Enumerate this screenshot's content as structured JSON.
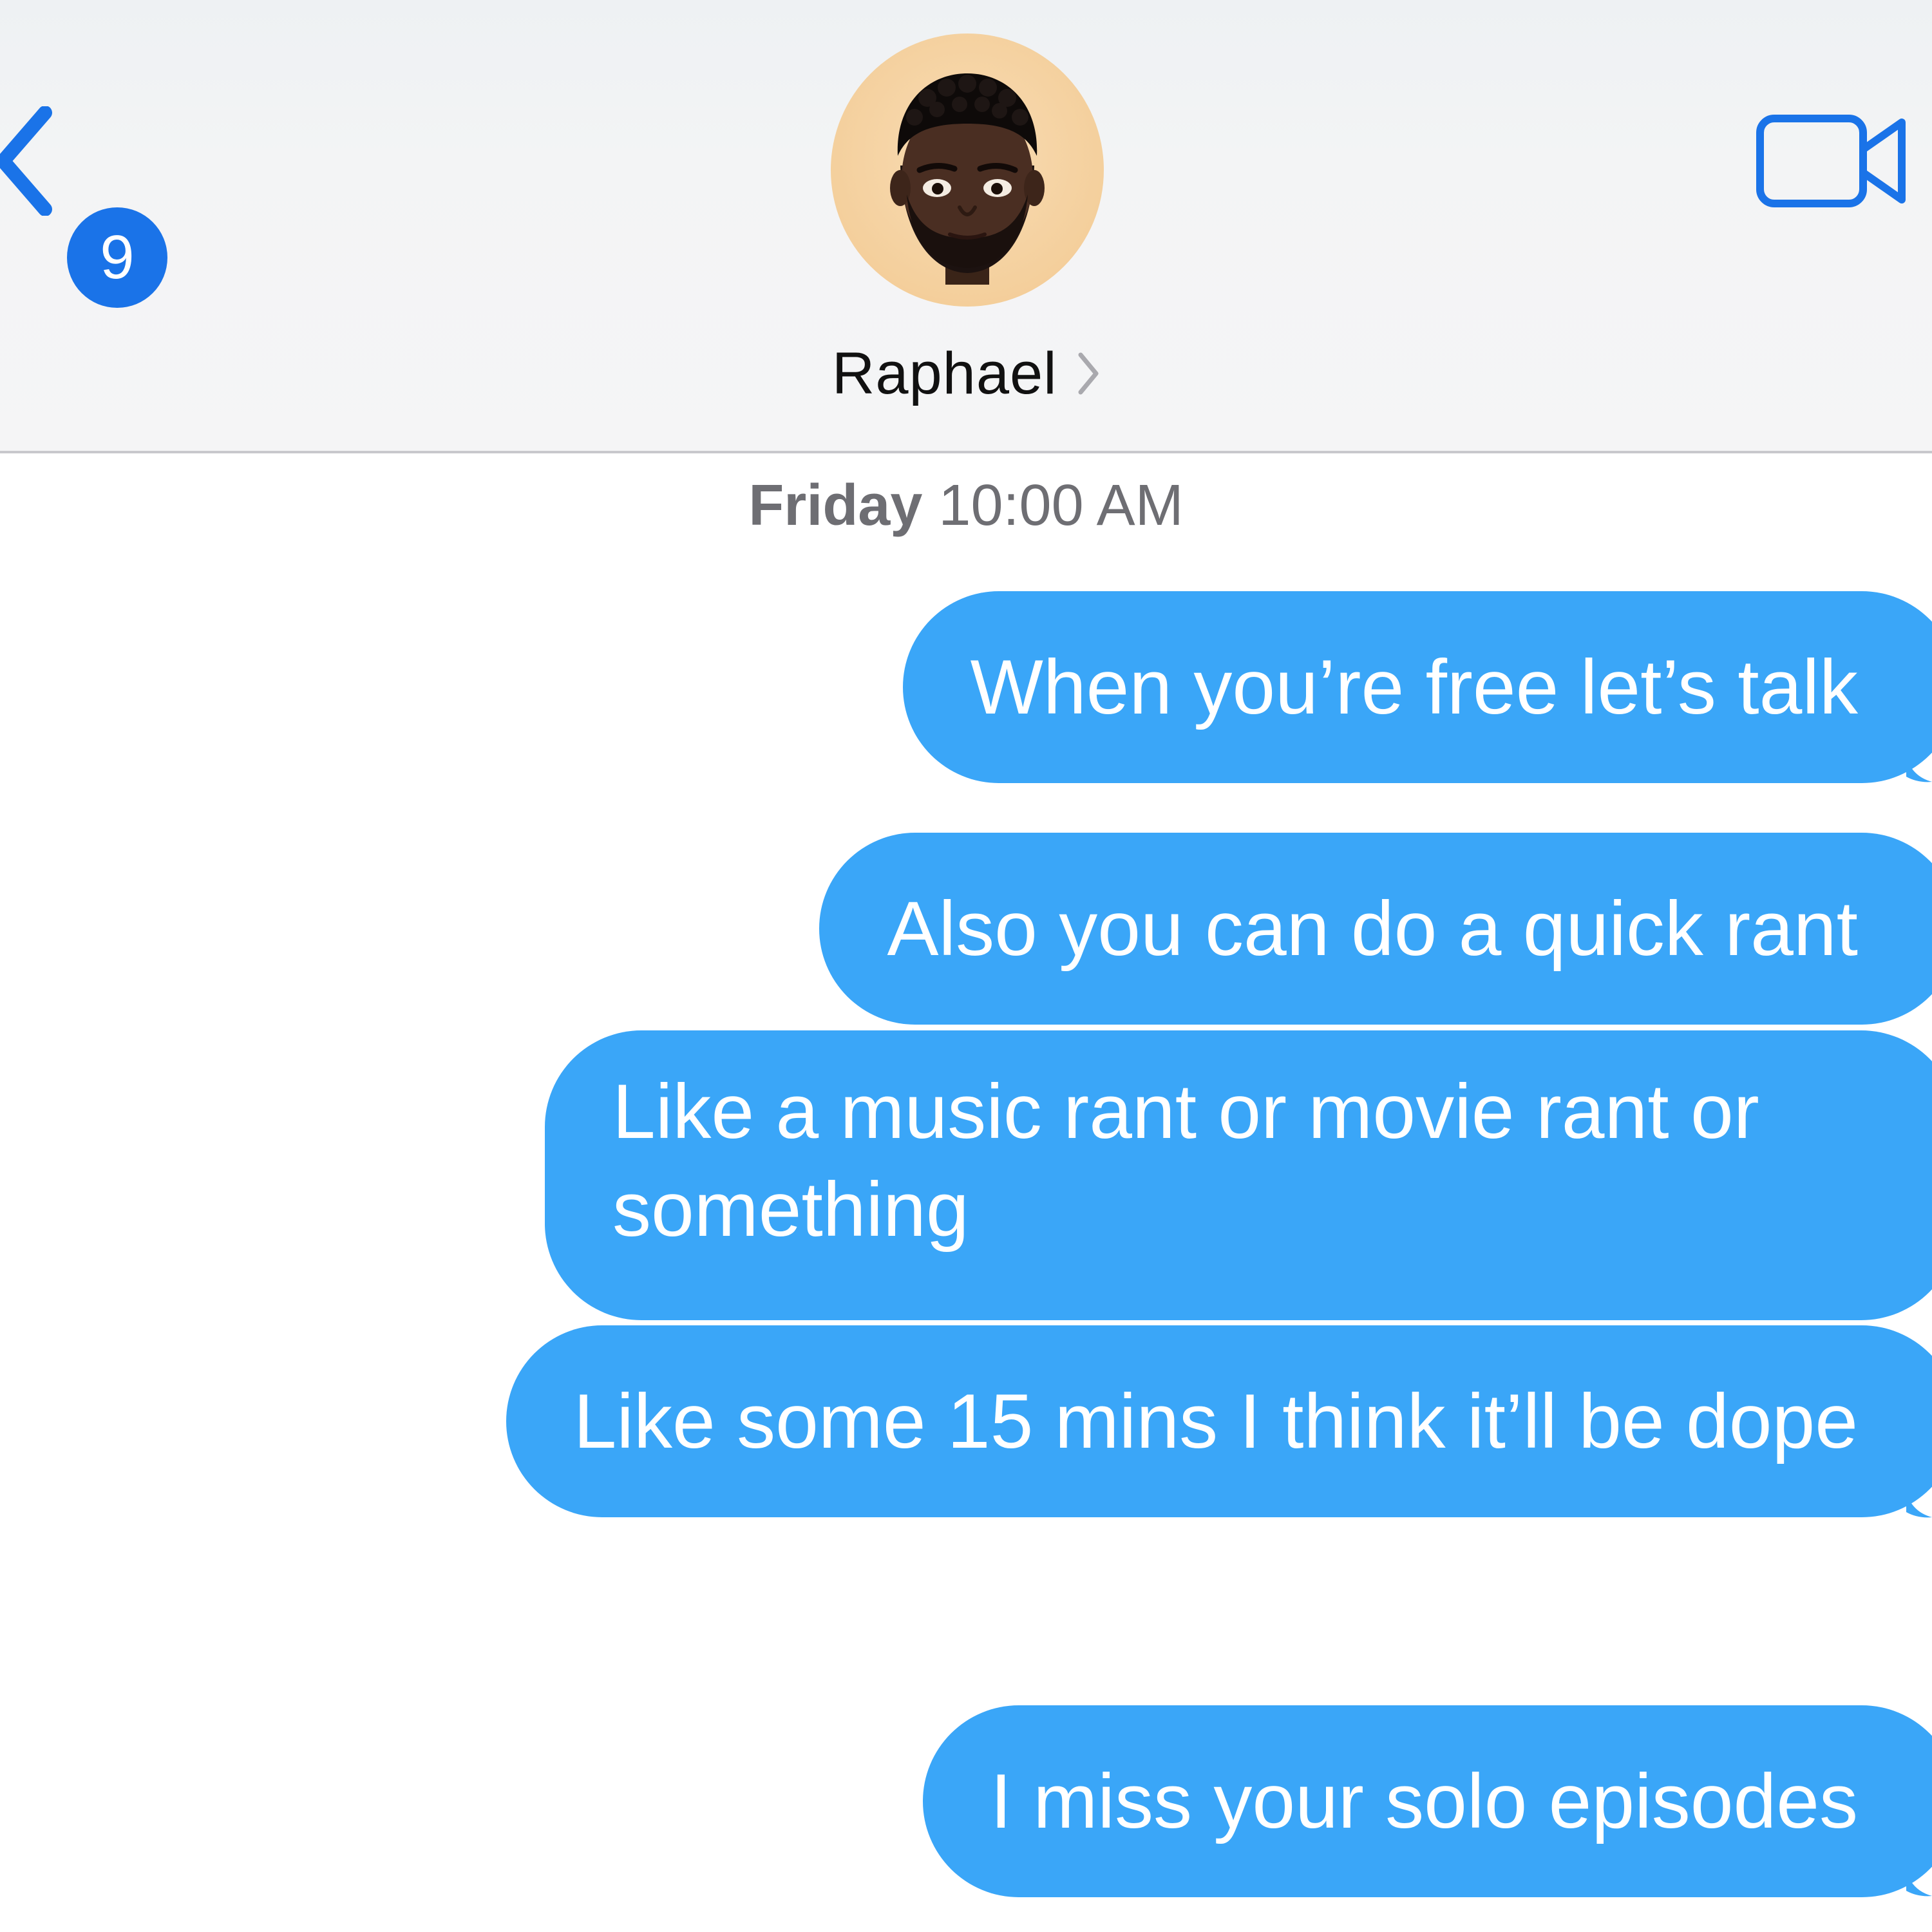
{
  "header": {
    "back_badge_count": "9",
    "contact_name": "Raphael",
    "colors": {
      "accent": "#1a73e8",
      "avatar_bg": "#f4cf9c"
    },
    "icons": {
      "back": "chevron-left-icon",
      "info": "chevron-right-icon",
      "video": "video-camera-icon",
      "avatar": "memoji-avatar"
    }
  },
  "conversation": {
    "timestamp_day": "Friday",
    "timestamp_time": "10:00 AM",
    "bubble_color": "#3aa6f8",
    "messages": [
      {
        "text": "When you’re free let’s talk",
        "sender": "me"
      },
      {
        "text": "Also you can do a quick rant",
        "sender": "me"
      },
      {
        "text": "Like a music rant or movie rant or something",
        "sender": "me"
      },
      {
        "text": "Like some 15 mins I think it’ll be dope",
        "sender": "me"
      },
      {
        "text": "I miss your solo episodes",
        "sender": "me"
      }
    ]
  }
}
